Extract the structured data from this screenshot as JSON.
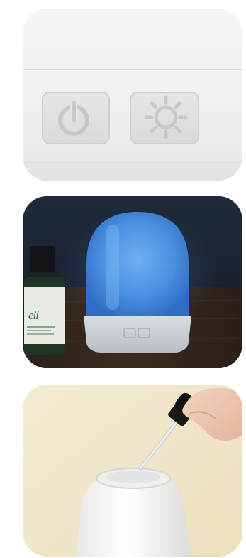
{
  "gallery": {
    "images": [
      {
        "id": "closeup",
        "subject": "diffuser-control-buttons",
        "icons": [
          "power-icon",
          "light-icon"
        ]
      },
      {
        "id": "lit",
        "subject": "diffuser-blue-glow-with-oil",
        "bottle_logo": "ell"
      },
      {
        "id": "dropper",
        "subject": "adding-oil-with-dropper"
      }
    ]
  },
  "colors": {
    "glow": "#4a8fe0",
    "background_dark": "#1a2330",
    "wood": "#3a2a1e",
    "cream": "#f1e7cb"
  }
}
